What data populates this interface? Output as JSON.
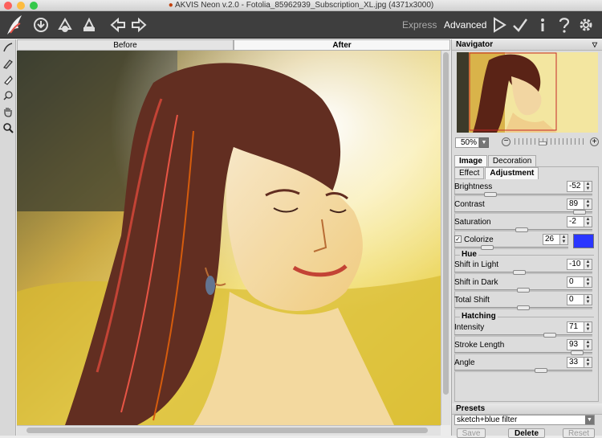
{
  "window": {
    "title": "AKVIS Neon v.2.0 - Fotolia_85962939_Subscription_XL.jpg (4371x3000)"
  },
  "toolbar": {
    "mode_express": "Express",
    "mode_advanced": "Advanced"
  },
  "view_tabs": {
    "before": "Before",
    "after": "After"
  },
  "navigator": {
    "title": "Navigator",
    "zoom": "50%"
  },
  "settings": {
    "tabs": {
      "image": "Image",
      "decoration": "Decoration"
    },
    "subtabs": {
      "effect": "Effect",
      "adjustment": "Adjustment"
    },
    "brightness": {
      "label": "Brightness",
      "value": "-52",
      "level": 0.24
    },
    "contrast": {
      "label": "Contrast",
      "value": "89",
      "level": 0.95
    },
    "saturation": {
      "label": "Saturation",
      "value": "-2",
      "level": 0.49
    },
    "colorize": {
      "label": "Colorize",
      "value": "26",
      "level": 0.26,
      "checked": true,
      "color": "#2a36ff"
    },
    "hue_group": "Hue",
    "shift_light": {
      "label": "Shift in Light",
      "value": "-10",
      "level": 0.47
    },
    "shift_dark": {
      "label": "Shift in Dark",
      "value": "0",
      "level": 0.5
    },
    "total_shift": {
      "label": "Total Shift",
      "value": "0",
      "level": 0.5
    },
    "hatching_group": "Hatching",
    "intensity": {
      "label": "Intensity",
      "value": "71",
      "level": 0.71
    },
    "stroke_length": {
      "label": "Stroke Length",
      "value": "93",
      "level": 0.93
    },
    "angle": {
      "label": "Angle",
      "value": "33",
      "level": 0.64
    }
  },
  "presets": {
    "title": "Presets",
    "selected": "sketch+blue filter",
    "save": "Save",
    "delete": "Delete",
    "reset": "Reset"
  },
  "colors": {
    "toolbar_bg": "#3e3e3e",
    "panel_bg": "#dcdcdc",
    "accent": "#2a36ff"
  }
}
